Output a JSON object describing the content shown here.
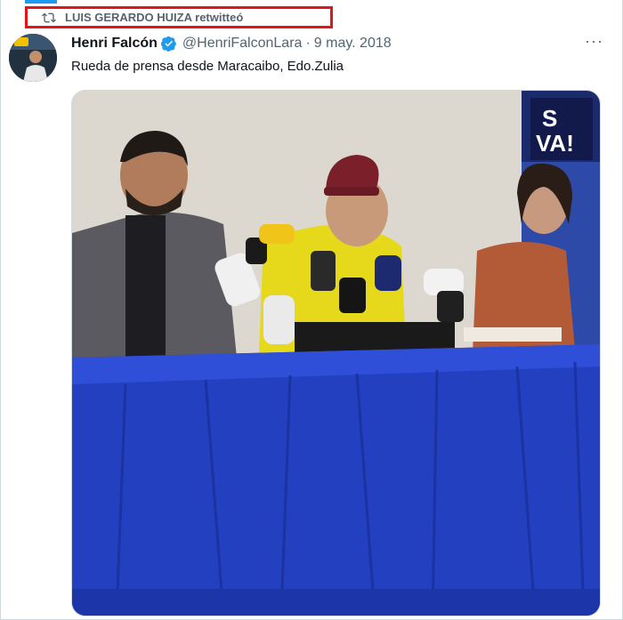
{
  "retweet": {
    "text": "LUIS GERARDO HUIZA retwitteó"
  },
  "tweet": {
    "author_name": "Henri Falcón",
    "handle": "@HenriFalconLara",
    "separator": "·",
    "date": "9 may. 2018",
    "text": "Rueda de prensa desde Maracaibo, Edo.Zulia",
    "more": "···"
  },
  "media": {
    "banner_text_top": "S",
    "banner_text_bottom": "VA!"
  },
  "colors": {
    "accent": "#1d9bf0",
    "highlight_box": "#e5141b",
    "table_blue": "#1f3fc2"
  }
}
